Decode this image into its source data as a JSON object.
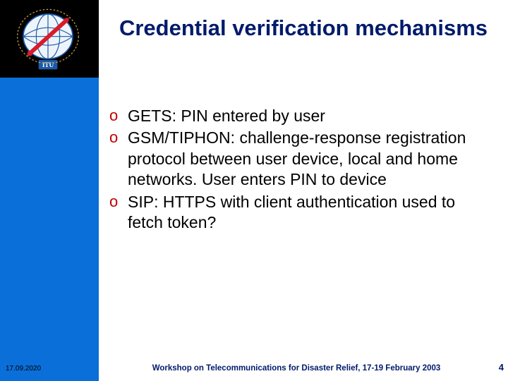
{
  "header": {
    "title": "Credential verification mechanisms",
    "logo_label": "ITU"
  },
  "bullets": {
    "items": [
      {
        "text": "GETS: PIN entered by user"
      },
      {
        "text": "GSM/TIPHON: challenge-response registration protocol between user device, local and home networks. User enters PIN to device"
      },
      {
        "text": "SIP: HTTPS with client authentication used to fetch token?"
      }
    ],
    "marker": "o"
  },
  "footer": {
    "date": "17.09.2020",
    "workshop": "Workshop on Telecommunications for Disaster Relief, 17-19 February 2003",
    "page": "4"
  },
  "colors": {
    "title": "#001a6b",
    "band": "#0a6fd8",
    "bullet_marker": "#c00000"
  }
}
